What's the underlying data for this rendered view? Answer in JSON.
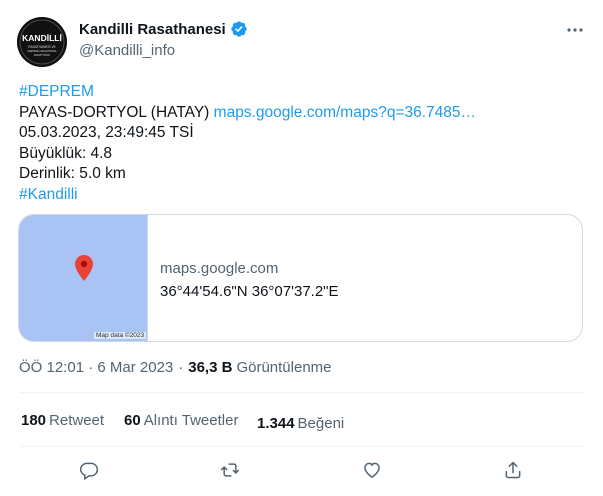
{
  "author": {
    "display_name": "Kandilli Rasathanesi",
    "handle": "@Kandilli_info",
    "avatar_text_top": "KANDİLLİ",
    "avatar_text_bottom": "RASATHANESİ VE DEPREM ARAŞTIRMA ENSTİTÜSÜ"
  },
  "tweet": {
    "hashtag_1": "#DEPREM",
    "location": "PAYAS-DORTYOL (HATAY)",
    "link": "maps.google.com/maps?q=36.7485…",
    "datetime": "05.03.2023, 23:49:45 TSİ",
    "magnitude": "Büyüklük: 4.8",
    "depth": "Derinlik: 5.0 km",
    "hashtag_2": "#Kandilli"
  },
  "card": {
    "map_credit": "Map data ©2023",
    "domain": "maps.google.com",
    "title": "36°44'54.6\"N 36°07'37.2\"E"
  },
  "meta": {
    "time": "ÖÖ 12:01 · 6 Mar 2023",
    "separator": "·",
    "views_count": "36,3 B",
    "views_label": "Görüntülenme"
  },
  "stats": {
    "retweets_count": "180",
    "retweets_label": "Retweet",
    "quotes_count": "60",
    "quotes_label": "Alıntı Tweetler",
    "likes_count": "1.344",
    "likes_label": "Beğeni"
  },
  "icons": {
    "verified": "verified-badge-icon",
    "more": "more-horizontal-icon",
    "reply": "reply-icon",
    "retweet": "retweet-icon",
    "like": "heart-icon",
    "share": "share-icon",
    "pin": "map-pin-icon"
  },
  "colors": {
    "accent": "#1d9bf0",
    "secondary_text": "#536471",
    "map_water": "#aac3f5",
    "pin": "#ea4335"
  }
}
